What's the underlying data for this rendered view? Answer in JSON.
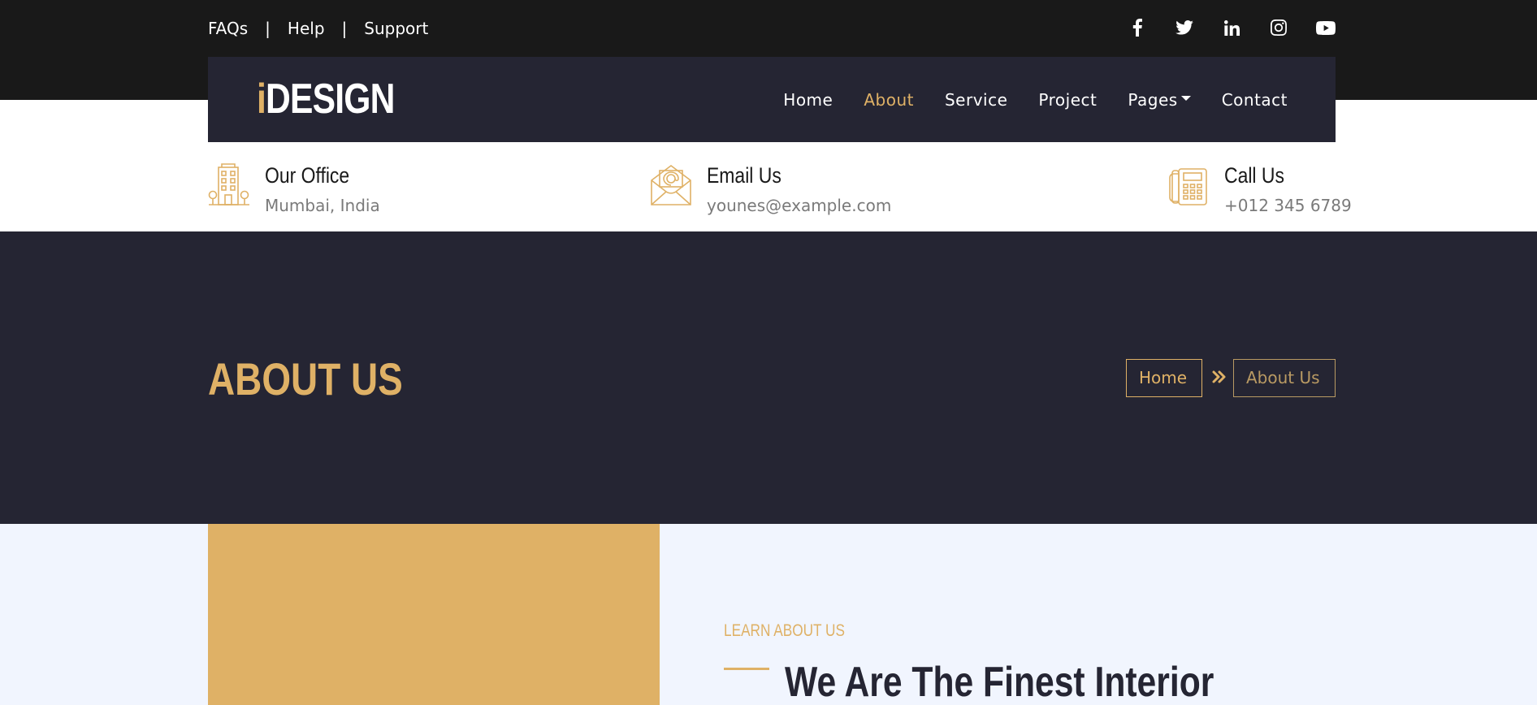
{
  "top_links": [
    "FAQs",
    "Help",
    "Support"
  ],
  "separator": "|",
  "socials": [
    "facebook-icon",
    "twitter-icon",
    "linkedin-icon",
    "instagram-icon",
    "youtube-icon"
  ],
  "logo": {
    "accent": "i",
    "rest": "DESIGN"
  },
  "nav": {
    "items": [
      "Home",
      "About",
      "Service",
      "Project",
      "Pages",
      "Contact"
    ],
    "active": "About"
  },
  "info": [
    {
      "title": "Our Office",
      "value": "Mumbai, India",
      "icon": "office-building-icon"
    },
    {
      "title": "Email Us",
      "value": "younes@example.com",
      "icon": "email-envelope-icon"
    },
    {
      "title": "Call Us",
      "value": "+012 345 6789",
      "icon": "telephone-icon"
    }
  ],
  "hero": {
    "title": "ABOUT US",
    "breadcrumb": [
      "Home",
      "About Us"
    ]
  },
  "about": {
    "eyebrow": "LEARN ABOUT US",
    "heading": "We Are The Finest Interior"
  },
  "colors": {
    "accent": "#dfb166",
    "dark": "#252533",
    "topbar": "#191919",
    "section_bg": "#f1f5fe"
  }
}
